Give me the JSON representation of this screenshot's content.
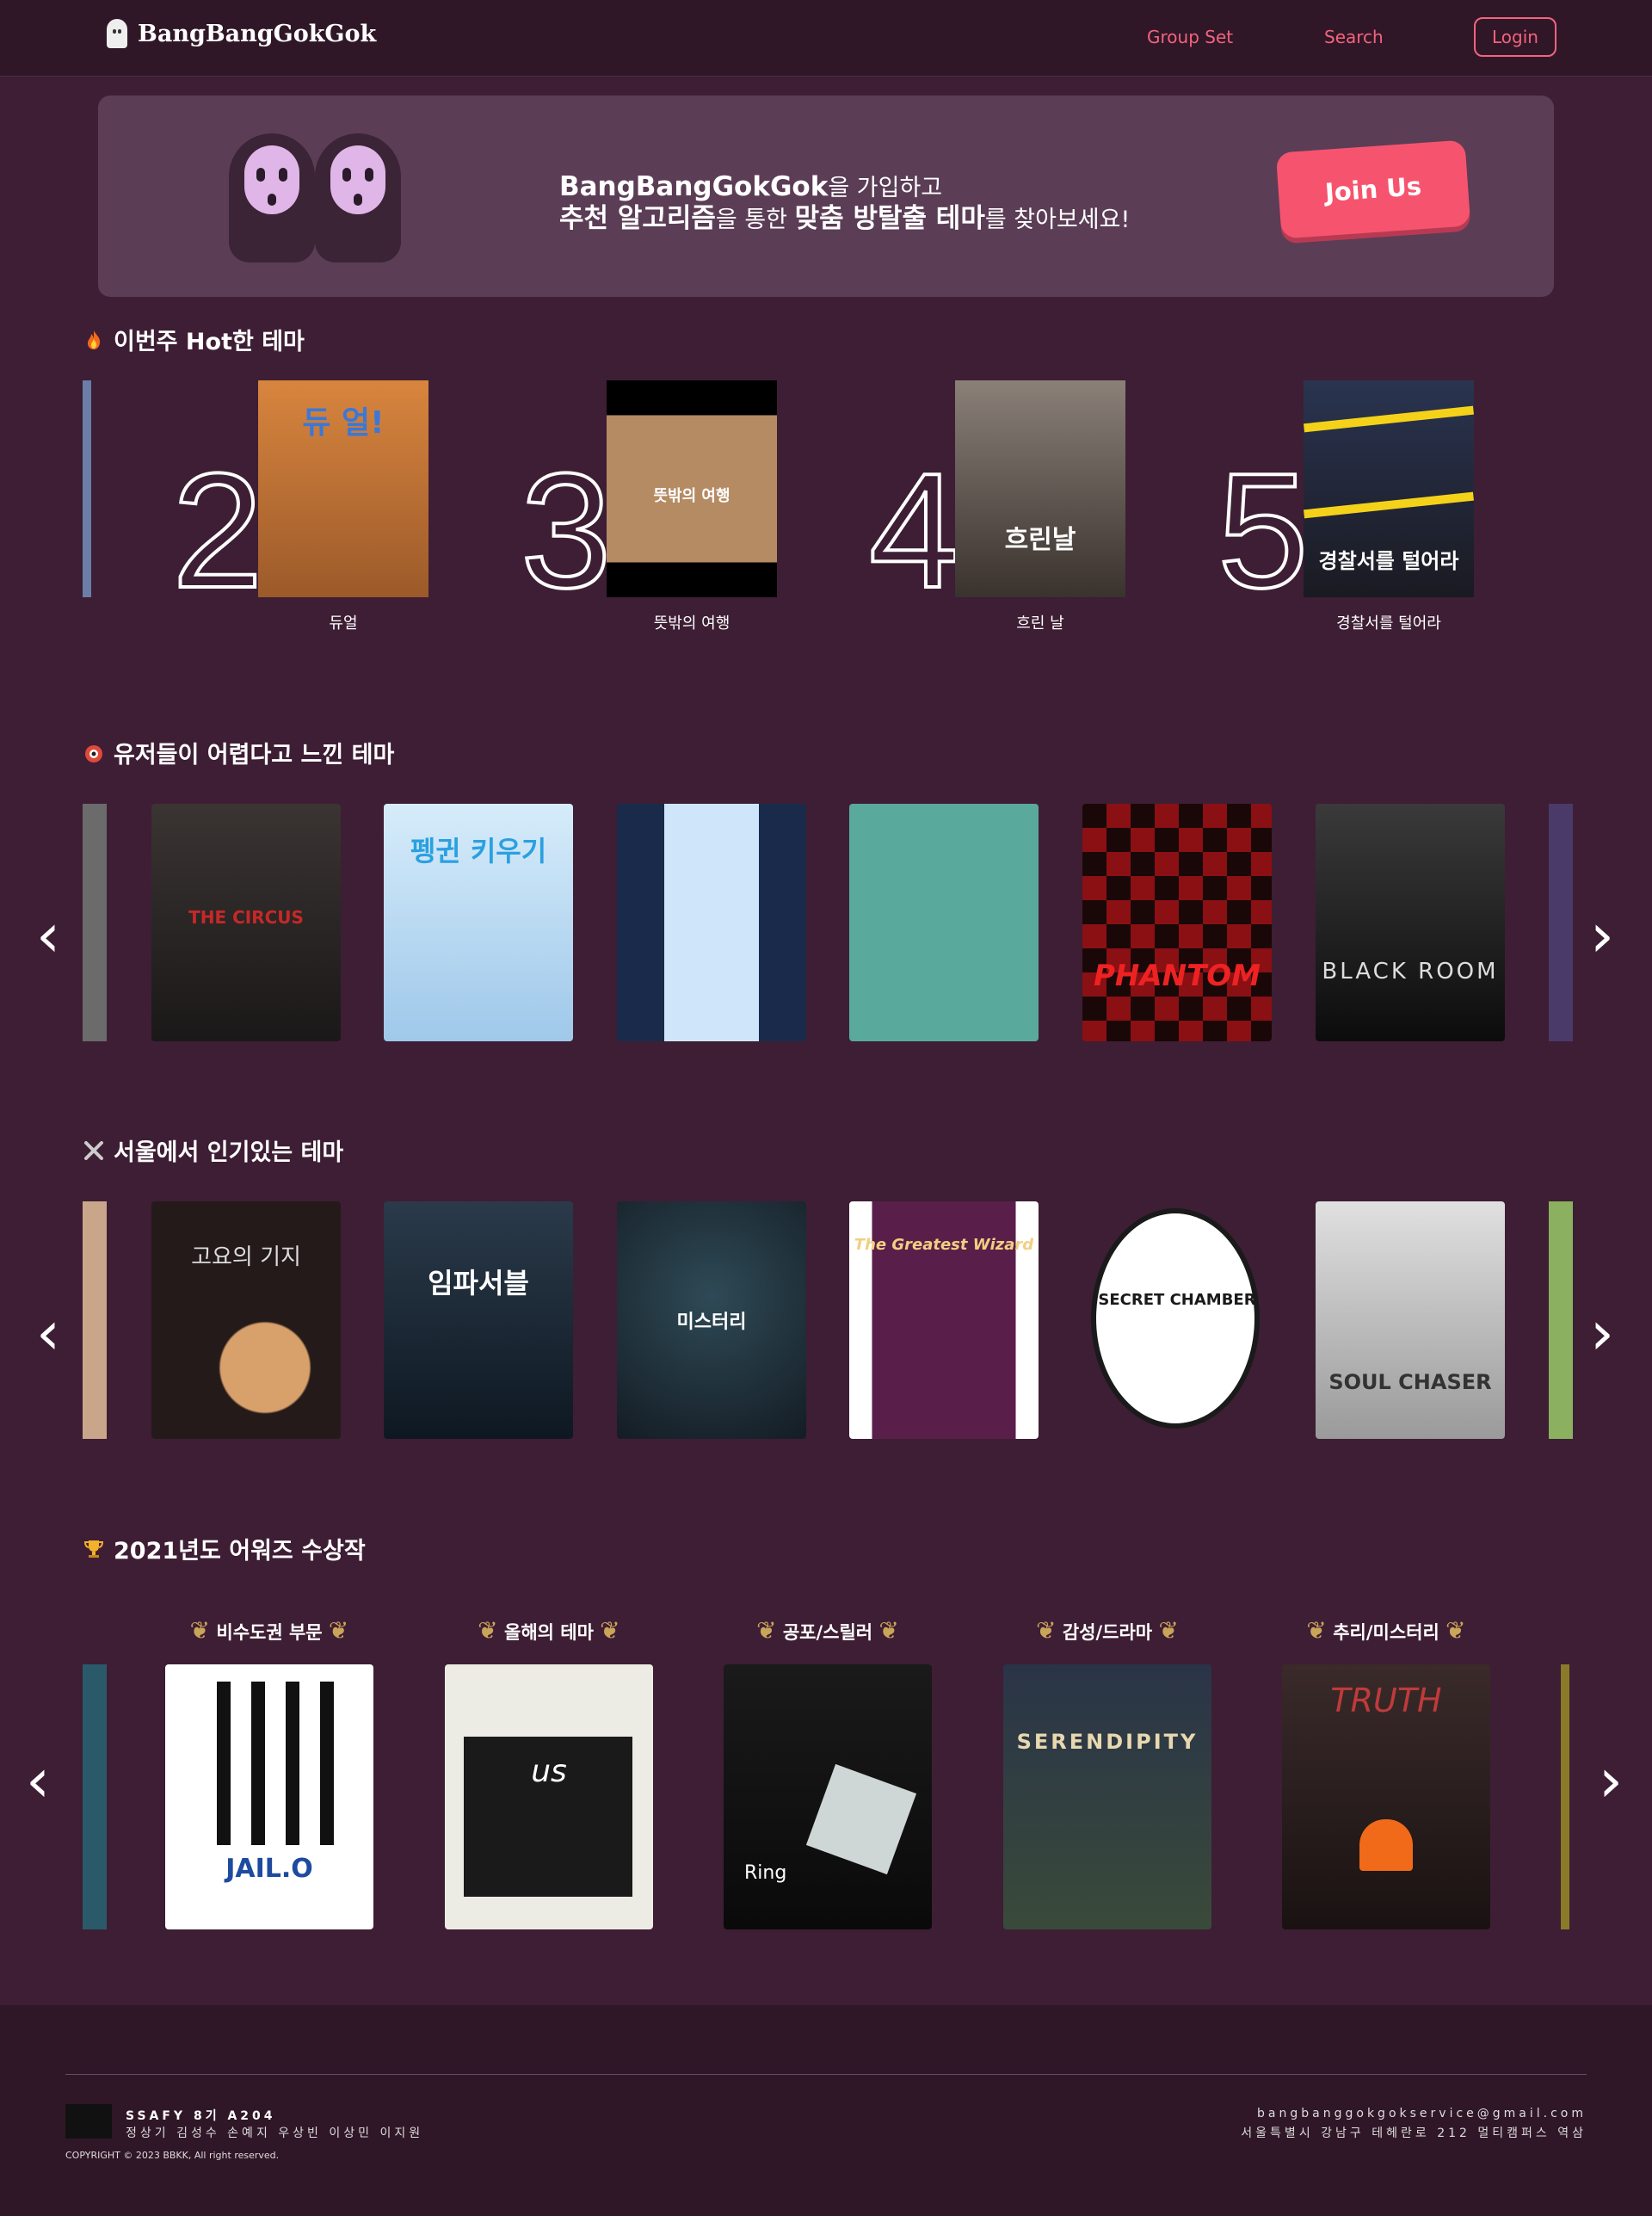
{
  "header": {
    "logo": "BangBangGokGok",
    "nav": [
      "Group Set",
      "Search"
    ],
    "login": "Login"
  },
  "banner": {
    "line1_bold": "BangBangGokGok",
    "line1_rest": "을 가입하고",
    "line2_b1": "추천 알고리즘",
    "line2_t1": "을 통한 ",
    "line2_b2": "맞춤 방탈출 테마",
    "line2_t2": "를 찾아보세요!",
    "join": "Join Us"
  },
  "hot": {
    "title": "이번주 Hot한 테마",
    "items": [
      {
        "rank": "2",
        "name": "듀얼",
        "poster_text": "듀 얼!",
        "color": "#c9743a"
      },
      {
        "rank": "3",
        "name": "뜻밖의 여행",
        "poster_text": "뜻밖의 여행",
        "color": "#b58b64"
      },
      {
        "rank": "4",
        "name": "흐린 날",
        "poster_text": "흐린날",
        "color": "#5a524c"
      },
      {
        "rank": "5",
        "name": "경찰서를 털어라",
        "poster_text": "경찰서를 털어라",
        "color": "#2a2e3a"
      }
    ]
  },
  "hard": {
    "title": "유저들이 어렵다고 느낀 테마",
    "posters": [
      {
        "text": "THE CIRCUS",
        "color": "#2e2a28"
      },
      {
        "text": "펭귄 키우기",
        "color": "#cfe6f6"
      },
      {
        "text": "",
        "color": "#9fb6d8"
      },
      {
        "text": "",
        "color": "#59a99c"
      },
      {
        "text": "PHANTOM",
        "color": "#7a1418"
      },
      {
        "text": "BLACK ROOM",
        "color": "#1c1c1c"
      }
    ]
  },
  "seoul": {
    "title": "서울에서 인기있는 테마",
    "posters": [
      {
        "text": "고요의 기지",
        "color": "#241a1a"
      },
      {
        "text": "임파서블",
        "color": "#1c2a38"
      },
      {
        "text": "미스터리",
        "color": "#1e2a34"
      },
      {
        "text": "The Greatest Wizard",
        "color": "#5a1e4a"
      },
      {
        "text": "SECRET CHAMBER",
        "color": "#3e1e34"
      },
      {
        "text": "SOUL CHASER",
        "color": "#cfcfcf"
      }
    ]
  },
  "awards": {
    "title": "2021년도 어워즈 수상작",
    "items": [
      {
        "label": "비수도권 부문",
        "poster_text": "JAIL.O",
        "color": "#ffffff"
      },
      {
        "label": "올해의 테마",
        "poster_text": "us",
        "color": "#ecebe4"
      },
      {
        "label": "공포/스릴러",
        "poster_text": "Ring",
        "color": "#141414"
      },
      {
        "label": "감성/드라마",
        "poster_text": "SERENDIPITY",
        "color": "#2c3646"
      },
      {
        "label": "추리/미스터리",
        "poster_text": "TRUTH",
        "color": "#2a1c1c"
      }
    ]
  },
  "footer": {
    "team": "SSAFY 8기 A204",
    "names": "정상기 김성수 손예지 우상빈 이상민 이지원",
    "copyright": "COPYRIGHT © 2023 BBKK, All right reserved.",
    "email": "bangbanggokgokservice@gmail.com",
    "address": "서울특별시 강남구 테헤란로 212 멀티캠퍼스 역삼"
  },
  "colors": {
    "accent": "#f2637e",
    "bg": "#3e1e34",
    "header": "#301727",
    "banner": "#5b3d56"
  }
}
